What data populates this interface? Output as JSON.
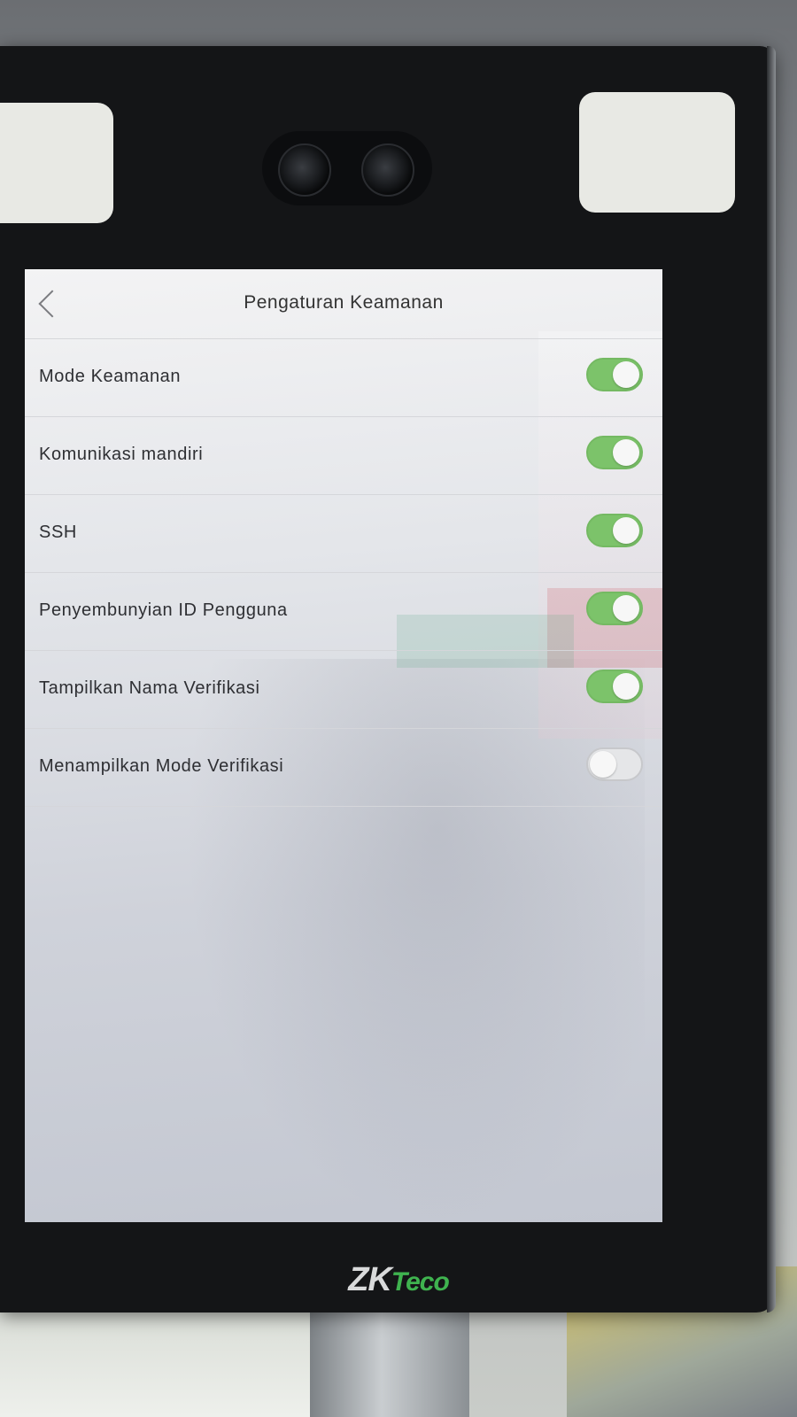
{
  "header": {
    "title": "Pengaturan Keamanan"
  },
  "settings": [
    {
      "label": "Mode Keamanan",
      "state": "on"
    },
    {
      "label": "Komunikasi mandiri",
      "state": "on"
    },
    {
      "label": "SSH",
      "state": "on"
    },
    {
      "label": "Penyembunyian ID Pengguna",
      "state": "on"
    },
    {
      "label": "Tampilkan Nama Verifikasi",
      "state": "on"
    },
    {
      "label": "Menampilkan Mode Verifikasi",
      "state": "off"
    }
  ],
  "brand": {
    "zk": "ZK",
    "teco": "Teco"
  },
  "colors": {
    "toggle_on": "#7cc36a",
    "brand_green": "#3fb34f"
  }
}
